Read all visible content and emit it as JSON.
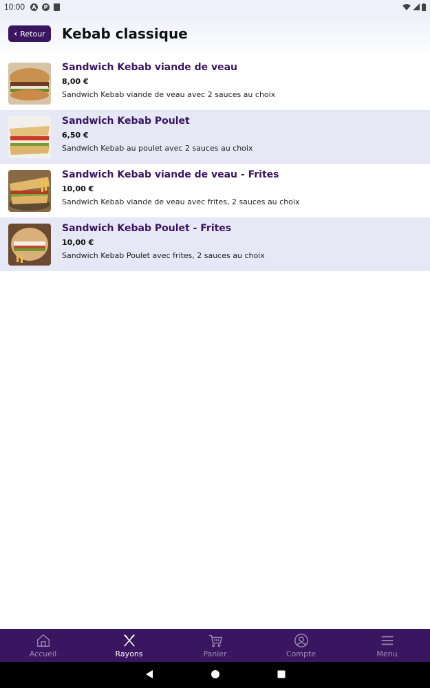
{
  "status_bar": {
    "time": "10:00",
    "icons": [
      "a-icon",
      "p-icon",
      "sd-icon",
      "wifi-icon",
      "signal-icon",
      "battery-icon"
    ]
  },
  "header": {
    "back_label": "Retour",
    "title": "Kebab classique"
  },
  "colors": {
    "brand": "#3a1560",
    "row_alt": "#e6e8f5",
    "nav_inactive": "#9d8db8"
  },
  "items": [
    {
      "name": "Sandwich Kebab viande de veau",
      "price": "8,00 €",
      "description": "Sandwich Kebab viande de veau avec 2 sauces au choix"
    },
    {
      "name": "Sandwich Kebab Poulet",
      "price": "6,50 €",
      "description": "Sandwich Kebab au poulet avec 2 sauces au choix"
    },
    {
      "name": "Sandwich Kebab viande de veau - Frites",
      "price": "10,00 €",
      "description": "Sandwich Kebab viande de veau avec frites, 2 sauces au choix"
    },
    {
      "name": "Sandwich Kebab Poulet - Frites",
      "price": "10,00 €",
      "description": "Sandwich Kebab Poulet avec frites, 2 sauces au choix"
    }
  ],
  "bottom_nav": [
    {
      "label": "Accueil",
      "icon": "home-icon",
      "active": false
    },
    {
      "label": "Rayons",
      "icon": "utensils-icon",
      "active": true
    },
    {
      "label": "Panier",
      "icon": "cart-icon",
      "active": false
    },
    {
      "label": "Compte",
      "icon": "account-icon",
      "active": false
    },
    {
      "label": "Menu",
      "icon": "menu-icon",
      "active": false
    }
  ]
}
